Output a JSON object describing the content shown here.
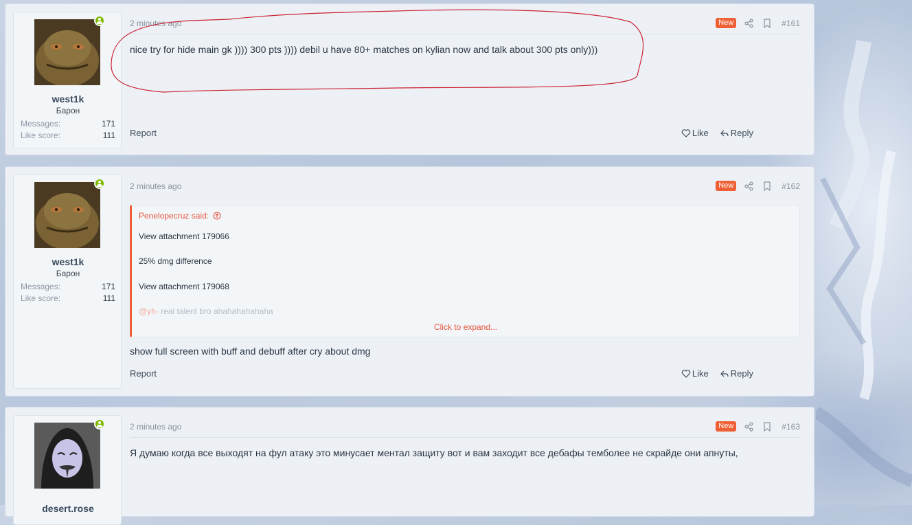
{
  "posts": [
    {
      "username": "west1k",
      "user_title": "Барон",
      "messages_label": "Messages:",
      "messages": "171",
      "like_score_label": "Like score:",
      "like_score": "111",
      "time": "2 minutes ago",
      "badge": "New",
      "number": "#161",
      "text": "nice try for hide main gk )))) 300 pts )))) debil u have 80+ matches on kylian now and talk about 300 pts only)))",
      "report": "Report",
      "like": "Like",
      "reply": "Reply"
    },
    {
      "username": "west1k",
      "user_title": "Барон",
      "messages_label": "Messages:",
      "messages": "171",
      "like_score_label": "Like score:",
      "like_score": "111",
      "time": "2 minutes ago",
      "badge": "New",
      "number": "#162",
      "quote": {
        "author_said": "Penelopecruz said:",
        "lines": [
          "View attachment 179066",
          "25% dmg difference",
          "View attachment 179068"
        ],
        "mention": "@yh-",
        "faded_text": " real talent bro ahahahahahaha",
        "expand": "Click to expand..."
      },
      "text": "show full screen with buff and debuff after cry about dmg",
      "report": "Report",
      "like": "Like",
      "reply": "Reply"
    },
    {
      "username": "desert.rose",
      "time": "2 minutes ago",
      "badge": "New",
      "number": "#163",
      "text": "Я думаю когда все выходят на фул атаку это минусает ментал защиту вот и вам заходит все дебафы темболее не скрайде они апнуты,"
    }
  ],
  "colors": {
    "accent": "#ef5f33",
    "online": "#7fb900",
    "annotation": "#cc2233"
  },
  "icons": [
    "share-icon",
    "bookmark-icon",
    "heart-icon",
    "reply-icon",
    "online-icon",
    "arrow-up-circle-icon"
  ]
}
